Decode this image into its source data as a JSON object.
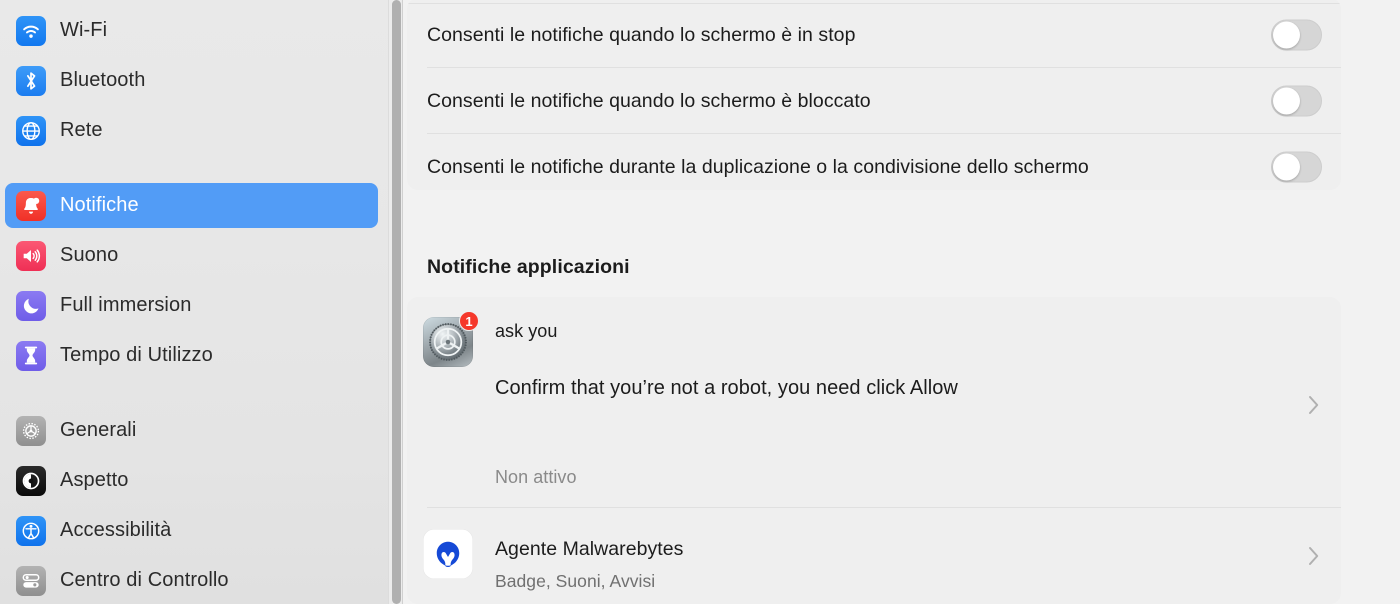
{
  "sidebar": {
    "groups": [
      {
        "items": [
          {
            "label": "Wi-Fi",
            "icon": "wifi-icon",
            "selected": false
          },
          {
            "label": "Bluetooth",
            "icon": "bluetooth-icon",
            "selected": false
          },
          {
            "label": "Rete",
            "icon": "globe-network-icon",
            "selected": false
          }
        ]
      },
      {
        "items": [
          {
            "label": "Notifiche",
            "icon": "bell-notification-icon",
            "selected": true
          },
          {
            "label": "Suono",
            "icon": "speaker-sound-icon",
            "selected": false
          },
          {
            "label": "Full immersion",
            "icon": "moon-focus-icon",
            "selected": false
          },
          {
            "label": "Tempo di Utilizzo",
            "icon": "hourglass-screentime-icon",
            "selected": false
          }
        ]
      },
      {
        "items": [
          {
            "label": "Generali",
            "icon": "gear-general-icon",
            "selected": false
          },
          {
            "label": "Aspetto",
            "icon": "appearance-contrast-icon",
            "selected": false
          },
          {
            "label": "Accessibilità",
            "icon": "accessibility-person-icon",
            "selected": false
          },
          {
            "label": "Centro di Controllo",
            "icon": "control-center-sliders-icon",
            "selected": false
          }
        ]
      }
    ]
  },
  "content": {
    "screen_options": {
      "rows": [
        {
          "label": "Consenti le notifiche quando lo schermo è in stop",
          "toggle": "off"
        },
        {
          "label": "Consenti le notifiche quando lo schermo è bloccato",
          "toggle": "off"
        },
        {
          "label": "Consenti le notifiche durante la duplicazione o la condivisione dello schermo",
          "toggle": "off"
        }
      ]
    },
    "app_notifications": {
      "section_title": "Notifiche applicazioni",
      "apps": [
        {
          "name": "ask you",
          "message": "Confirm that you’re not a robot, you need click Allow",
          "status": "Non attivo",
          "icon": "system-settings-gear-icon",
          "badge": "1",
          "chevron": "chevron-right-icon"
        },
        {
          "name": "Agente Malwarebytes",
          "subtitle": "Badge, Suoni, Avvisi",
          "icon": "malwarebytes-icon",
          "chevron": "chevron-right-icon"
        }
      ]
    }
  },
  "colors": {
    "accent_selection": "#529cf6",
    "badge_red": "#f5382b",
    "sidebar_bg": "#e7e7e7",
    "content_bg": "#f2f2f2",
    "card_bg": "#efefef",
    "switch_off": "#d6d6d6"
  }
}
